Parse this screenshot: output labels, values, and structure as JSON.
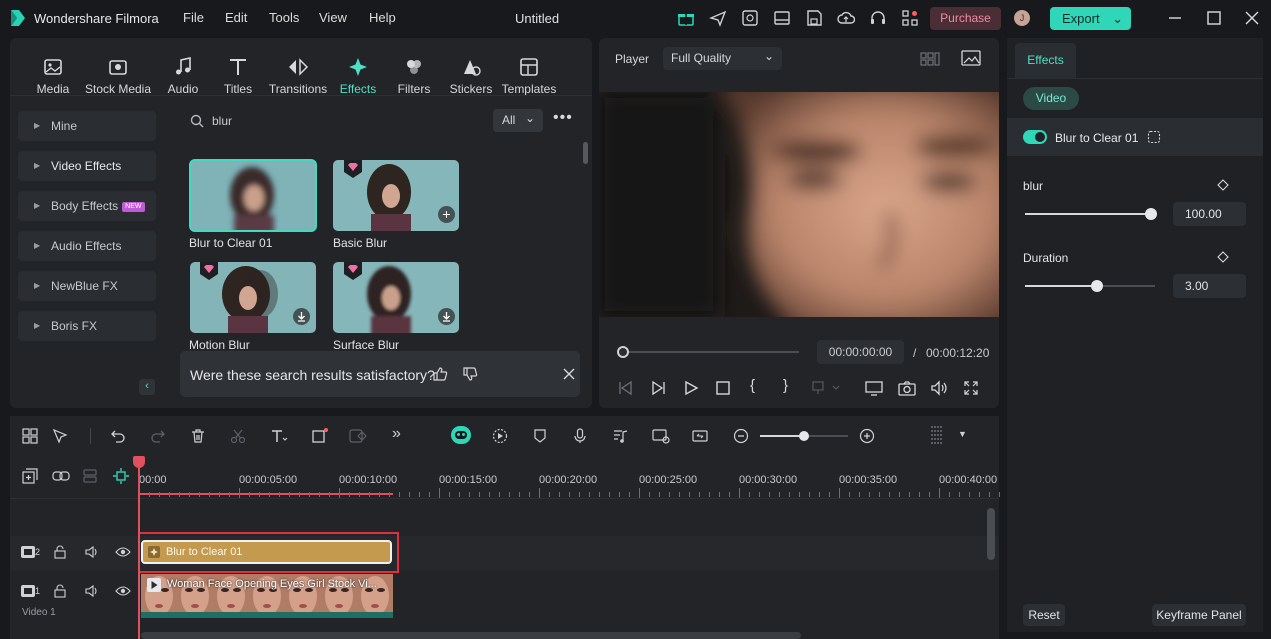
{
  "titlebar": {
    "app_name": "Wondershare Filmora",
    "menus": [
      "File",
      "Edit",
      "Tools",
      "View",
      "Help"
    ],
    "doc_title": "Untitled",
    "purchase": "Purchase",
    "avatar_letter": "J",
    "export": "Export"
  },
  "toolbar": {
    "tabs": [
      "Media",
      "Stock Media",
      "Audio",
      "Titles",
      "Transitions",
      "Effects",
      "Filters",
      "Stickers",
      "Templates"
    ],
    "active": "Effects"
  },
  "sidebar": {
    "items": [
      {
        "label": "Mine"
      },
      {
        "label": "Video Effects"
      },
      {
        "label": "Body Effects",
        "badge": "NEW"
      },
      {
        "label": "Audio Effects"
      },
      {
        "label": "NewBlue FX"
      },
      {
        "label": "Boris FX"
      }
    ]
  },
  "search": {
    "value": "blur",
    "filter": "All"
  },
  "results": [
    {
      "label": "Blur to Clear 01"
    },
    {
      "label": "Basic Blur"
    },
    {
      "label": "Motion Blur"
    },
    {
      "label": "Surface Blur"
    }
  ],
  "feedback": {
    "question": "Were these search results satisfactory?"
  },
  "player": {
    "label": "Player",
    "quality": "Full Quality",
    "current_time": "00:00:00:00",
    "separator": "/",
    "total_time": "00:00:12:20"
  },
  "effects_panel": {
    "tab": "Effects",
    "subtab": "Video",
    "effect_name": "Blur to Clear 01",
    "params": [
      {
        "name": "blur",
        "value": "100.00",
        "level": 1.0
      },
      {
        "name": "Duration",
        "value": "3.00",
        "level": 0.55
      }
    ],
    "reset": "Reset",
    "keyframe": "Keyframe Panel"
  },
  "timeline": {
    "ruler": [
      "00:00",
      "00:00:05:00",
      "00:00:10:00",
      "00:00:15:00",
      "00:00:20:00",
      "00:00:25:00",
      "00:00:30:00",
      "00:00:35:00",
      "00:00:40:00"
    ],
    "track2_num": "2",
    "track1_num": "1",
    "track1_name": "Video 1",
    "effect_clip": "Blur to Clear 01",
    "video_clip": "Woman Face Opening Eyes Girl  Stock Vi..."
  },
  "colors": {
    "accent": "#2fd7b8",
    "effect_clip": "#c49a4e",
    "purchase": "#f28aa4"
  }
}
